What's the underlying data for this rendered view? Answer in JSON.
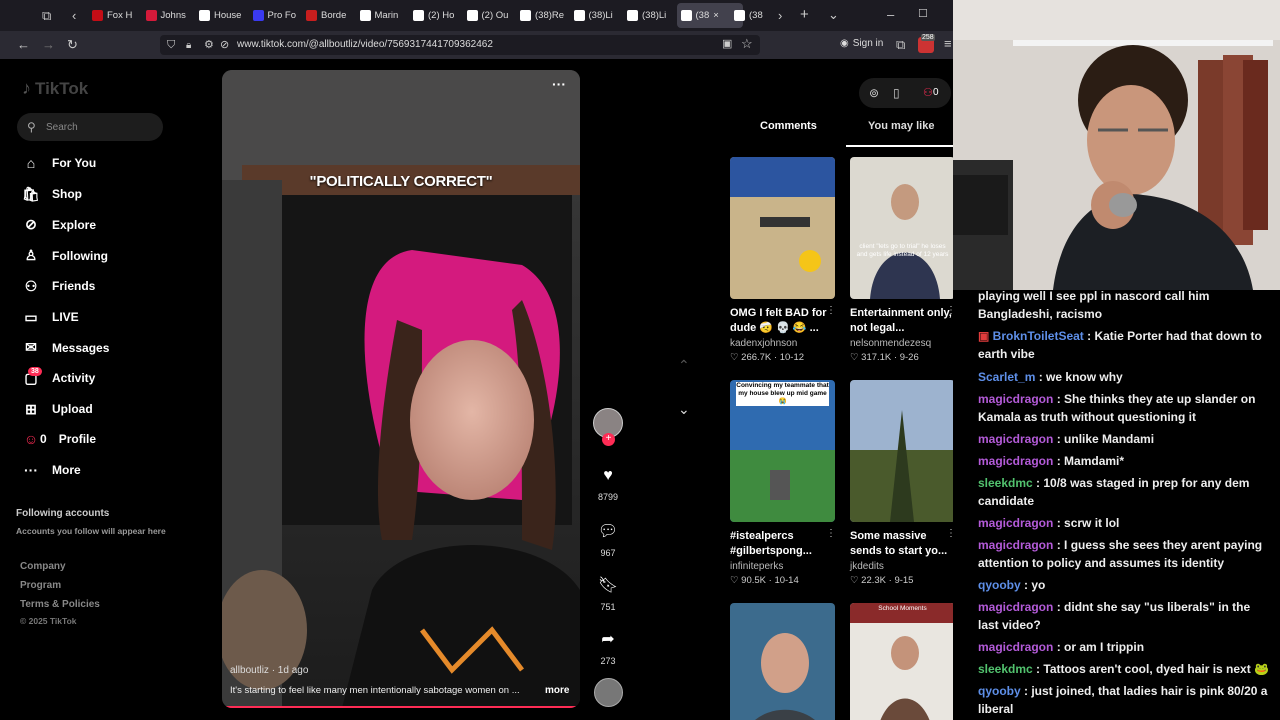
{
  "browser": {
    "tabs": [
      {
        "label": "Fox H",
        "color": "#c40d16"
      },
      {
        "label": "Johns",
        "color": "#d41a3a"
      },
      {
        "label": "House",
        "color": "#ffffff"
      },
      {
        "label": "Pro Fo",
        "color": "#3a3af0"
      },
      {
        "label": "Borde",
        "color": "#c81e1e"
      },
      {
        "label": "Marin",
        "color": "#ffffff"
      },
      {
        "label": "(2) Ho",
        "color": "#ffffff"
      },
      {
        "label": "(2) Ou",
        "color": "#ffffff"
      },
      {
        "label": "(38)Re",
        "color": "#ffffff"
      },
      {
        "label": "(38)Li",
        "color": "#ffffff"
      },
      {
        "label": "(38)Li",
        "color": "#ffffff"
      },
      {
        "label": "(38",
        "color": "#ffffff"
      },
      {
        "label": "(38",
        "color": "#ffffff"
      }
    ],
    "url": "www.tiktok.com/@allboutliz/video/7569317441709362462",
    "sign_in": "Sign in",
    "ext_badge": "258"
  },
  "sidebar": {
    "logo": "TikTok",
    "search_placeholder": "Search",
    "items": [
      {
        "label": "For You",
        "icon": "home-icon"
      },
      {
        "label": "Shop",
        "icon": "shop-icon"
      },
      {
        "label": "Explore",
        "icon": "compass-icon"
      },
      {
        "label": "Following",
        "icon": "following-icon"
      },
      {
        "label": "Friends",
        "icon": "friends-icon"
      },
      {
        "label": "LIVE",
        "icon": "live-icon"
      },
      {
        "label": "Messages",
        "icon": "messages-icon"
      },
      {
        "label": "Activity",
        "icon": "activity-icon"
      },
      {
        "label": "Upload",
        "icon": "upload-icon"
      },
      {
        "label": "Profile",
        "icon": "profile-icon"
      },
      {
        "label": "More",
        "icon": "more-icon"
      }
    ],
    "activity_badge": "38",
    "profile_prefix": "0",
    "following_title": "Following accounts",
    "following_sub": "Accounts you follow will appear here",
    "footer": [
      "Company",
      "Program",
      "Terms & Policies",
      "© 2025 TikTok"
    ]
  },
  "video": {
    "caption_overlay": "\"POLITICALLY CORRECT\"",
    "author": "allboutliz",
    "age": "· 1d ago",
    "description": "It's starting to feel like many men intentionally sabotage women on ...",
    "more": "more",
    "likes": "8799",
    "comments": "967",
    "saves": "751",
    "shares": "273"
  },
  "right_panel": {
    "tab_comments": "Comments",
    "tab_you_may_like": "You may like",
    "top_badge": "0",
    "cards": [
      {
        "title": "OMG I felt BAD for dude 🤕 💀 😂 ...",
        "user": "kadenxjohnson",
        "likes": "266.7K",
        "date": "10-12"
      },
      {
        "title": "Entertainment only, not legal...",
        "user": "nelsonmendezesq",
        "likes": "317.1K",
        "date": "9-26",
        "overlay": "client \"lets go to trial\" he loses and gets life instead of 12 years"
      },
      {
        "title": "#istealpercs #gilbertspong...",
        "user": "infiniteperks",
        "likes": "90.5K",
        "date": "10-14",
        "overlay": "Convincing my teammate that my house blew up mid game😭"
      },
      {
        "title": "Some massive sends to start yo...",
        "user": "jkdedits",
        "likes": "22.3K",
        "date": "9-15"
      },
      {
        "title": "",
        "user": "",
        "likes": "",
        "date": ""
      },
      {
        "title": "",
        "user": "",
        "likes": "",
        "date": "",
        "overlay": "School Moments"
      }
    ]
  },
  "chat": {
    "messages": [
      {
        "user": "",
        "color": "#eeeeee",
        "text": "playing well I see ppl in nascord call him Bangladeshi, racismo"
      },
      {
        "user": "BroknToiletSeat",
        "color": "#5e8fe8",
        "text": "Katie Porter had that down to earth vibe"
      },
      {
        "user": "Scarlet_m",
        "color": "#5e8fe8",
        "text": "we know why"
      },
      {
        "user": "magicdragon",
        "color": "#b45bd9",
        "text": "She thinks they ate up slander on Kamala as truth without questioning it"
      },
      {
        "user": "magicdragon",
        "color": "#b45bd9",
        "text": "unlike Mandami"
      },
      {
        "user": "magicdragon",
        "color": "#b45bd9",
        "text": "Mamdami*"
      },
      {
        "user": "sleekdmc",
        "color": "#52c26e",
        "text": "10/8 was staged in prep for any dem candidate"
      },
      {
        "user": "magicdragon",
        "color": "#b45bd9",
        "text": "scrw it lol"
      },
      {
        "user": "magicdragon",
        "color": "#b45bd9",
        "text": "I guess she sees they arent paying attention to policy and assumes its identity"
      },
      {
        "user": "qyooby",
        "color": "#5e8fe8",
        "text": "yo"
      },
      {
        "user": "magicdragon",
        "color": "#b45bd9",
        "text": "didnt she say \"us liberals\" in the last video?"
      },
      {
        "user": "magicdragon",
        "color": "#b45bd9",
        "text": "or am I trippin"
      },
      {
        "user": "sleekdmc",
        "color": "#52c26e",
        "text": "Tattoos aren't cool, dyed hair is next 🐸"
      },
      {
        "user": "qyooby",
        "color": "#5e8fe8",
        "text": "just joined, that ladies hair is pink 80/20 a liberal"
      }
    ]
  },
  "colors": {
    "accent": "#fe2c55",
    "bg": "#000000",
    "tabbar": "#1c1b22"
  }
}
